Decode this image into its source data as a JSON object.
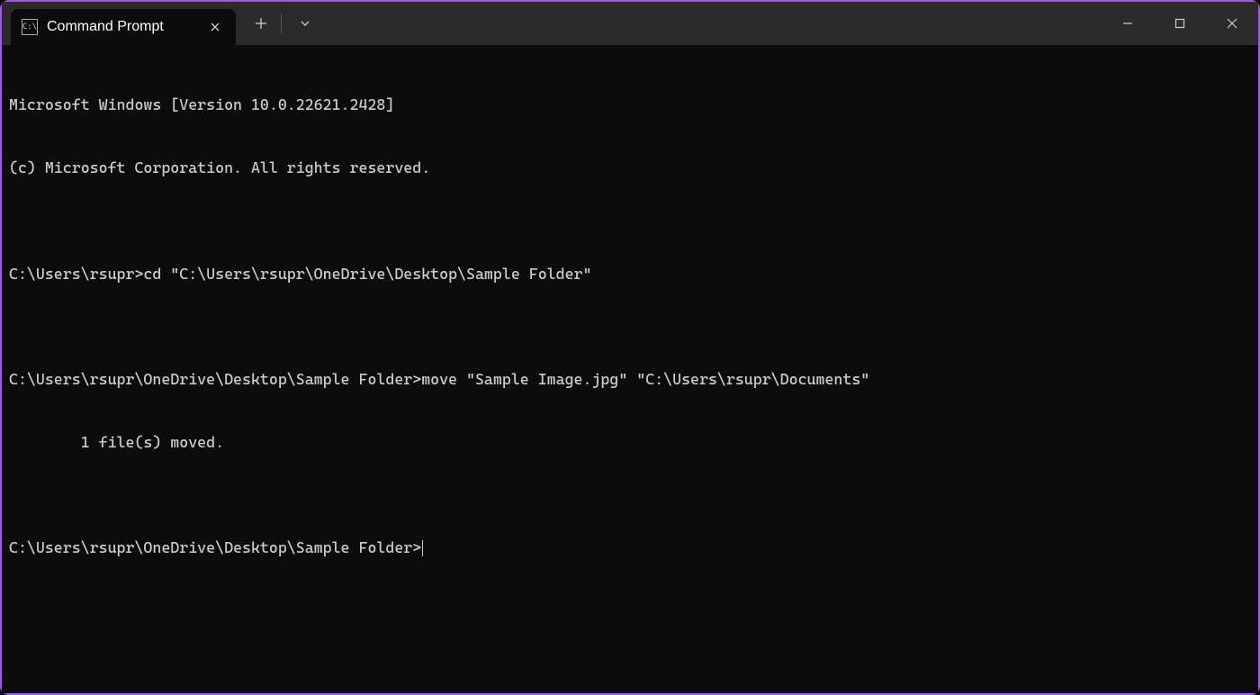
{
  "titlebar": {
    "tab_title": "Command Prompt",
    "tab_icon_glyph": "C:\\"
  },
  "terminal": {
    "lines": [
      "Microsoft Windows [Version 10.0.22621.2428]",
      "(c) Microsoft Corporation. All rights reserved.",
      "",
      "C:\\Users\\rsupr>cd \"C:\\Users\\rsupr\\OneDrive\\Desktop\\Sample Folder\"",
      "",
      "C:\\Users\\rsupr\\OneDrive\\Desktop\\Sample Folder>move \"Sample Image.jpg\" \"C:\\Users\\rsupr\\Documents\"",
      "        1 file(s) moved.",
      "",
      "C:\\Users\\rsupr\\OneDrive\\Desktop\\Sample Folder>"
    ]
  }
}
